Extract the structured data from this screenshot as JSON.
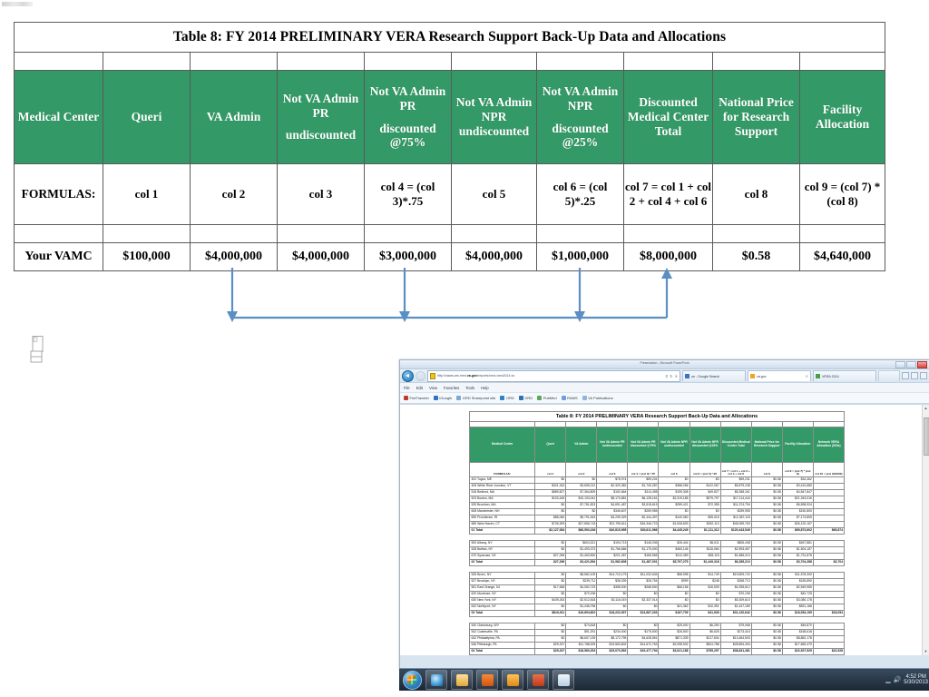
{
  "slide": {
    "table": {
      "title": "Table 8: FY 2014 PRELIMINARY VERA Research Support Back-Up Data and Allocations",
      "headers": [
        {
          "main": "Medical Center",
          "sub": ""
        },
        {
          "main": "Queri",
          "sub": ""
        },
        {
          "main": "VA Admin",
          "sub": ""
        },
        {
          "main": "Not VA Admin PR",
          "sub": "undiscounted"
        },
        {
          "main": "Not VA Admin PR",
          "sub": "discounted @75%"
        },
        {
          "main": "Not VA Admin NPR undiscounted",
          "sub": ""
        },
        {
          "main": "Not VA Admin NPR",
          "sub": "discounted @25%"
        },
        {
          "main": "Discounted Medical Center Total",
          "sub": ""
        },
        {
          "main": "National Price for Research Support",
          "sub": ""
        },
        {
          "main": "Facility Allocation",
          "sub": ""
        }
      ],
      "formula_label": "FORMULAS:",
      "formulas": [
        "col 1",
        "col 2",
        "col 3",
        "col 4 = (col 3)*.75",
        "col 5",
        "col 6 = (col 5)*.25",
        "col 7 = col 1 + col 2 + col 4 + col 6",
        "col 8",
        "col 9 = (col 7) * (col 8)"
      ],
      "data_row_label": "Your VAMC",
      "data_values": [
        "$100,000",
        "$4,000,000",
        "$4,000,000",
        "$3,000,000",
        "$4,000,000",
        "$1,000,000",
        "$8,000,000",
        "$0.58",
        "$4,640,000"
      ]
    },
    "arrows": {
      "color": "#5b8fc4",
      "description": "col 1, col 4 and col 6 flow down and combine into col 7"
    }
  },
  "browser": {
    "window_title": "Presentation - Microsoft PowerPoint",
    "address": {
      "url_prefix": "http://vaww.ars.med.",
      "url_bold": "va.gov",
      "url_suffix": "/reports/vera-vera2014.vs",
      "search_icon": "search-icon",
      "refresh_icon": "refresh-icon",
      "stop_icon": "close-icon"
    },
    "tabs": [
      {
        "title": "ue - Google Search",
        "favicon": "#3b73c4"
      },
      {
        "title": "va.gov",
        "favicon": "#f0a32a"
      },
      {
        "title": "VERA 2014",
        "favicon": "#4a9e4a"
      }
    ],
    "menu": [
      "File",
      "Edit",
      "View",
      "Favorites",
      "Tools",
      "Help"
    ],
    "favorites": [
      {
        "label": "FedTraveler",
        "color": "#c0392b"
      },
      {
        "label": "iGoogle",
        "color": "#2f6fc4"
      },
      {
        "label": "ORD Sharepoint site",
        "color": "#7ea6d4"
      },
      {
        "label": "ORD",
        "color": "#2f80c4"
      },
      {
        "label": "ORD",
        "color": "#2f6fb4"
      },
      {
        "label": "PubMed",
        "color": "#5ba85b"
      },
      {
        "label": "RAMS",
        "color": "#6f9fd8"
      },
      {
        "label": "VA Publications",
        "color": "#8fb5dd"
      }
    ],
    "document": {
      "title": "Table 8:  FY 2014 PRELIMINARY VERA Research Support Back-Up Data and Allocations",
      "headers": [
        "Medical Center",
        "Queri",
        "VA Admin",
        "Not VA Admin PR undiscounted",
        "Not VA Admin PR discounted @75%",
        "Not VA Admin NPR undiscounted",
        "Not VA Admin NPR discounted @25%",
        "Discounted Medical Center Total",
        "National Price for Research Support",
        "Facility Allocation",
        "Network VERA Allocation (000s)"
      ],
      "formula_label": "FORMULAS:",
      "formulas": [
        "col 1",
        "col 2",
        "col 3",
        "col 4 = (col 3) *.75",
        "col 5",
        "col 6 = (col 5) *.25",
        "col 7 = col 1 + col 2 + col 4 + col 6",
        "col 8",
        "col 9 = (col 7) * (col 8)",
        "col 10 = (col 9)/1000)"
      ],
      "rows": [
        {
          "name": "402 Togus, ME",
          "cells": [
            "$0",
            "$0",
            "$78,974",
            "$59,231",
            "$0",
            "$0",
            "$59,231",
            "$0.58",
            "$34,362",
            ""
          ]
        },
        {
          "name": "405 White River Junction, VT",
          "cells": [
            "$321,343",
            "$3,695,212",
            "$2,320,382",
            "$1,740,287",
            "$488,266",
            "$122,067",
            "$5,879,108",
            "$0.58",
            "$3,410,680",
            ""
          ]
        },
        {
          "name": "518 Bedford, MA",
          "cells": [
            "$889,827",
            "$7,364,809",
            "$152,664",
            "$114,498",
            "$199,308",
            "$49,827",
            "$8,358,161",
            "$0.58",
            "$4,847,847",
            ""
          ]
        },
        {
          "name": "523 Boston, MA",
          "cells": [
            "$103,445",
            "$10,103,041",
            "$8,170,881",
            "$6,128,161",
            "$2,319,185",
            "$579,797",
            "$17,114,444",
            "$0.58",
            "$21,343,016",
            ""
          ]
        },
        {
          "name": "525 Brockton, MA",
          "cells": [
            "$0",
            "$7,781,823",
            "$4,691,487",
            "$3,518,615",
            "$289,421",
            "$72,355",
            "$11,374,794",
            "$0.58",
            "$6,598,924",
            ""
          ]
        },
        {
          "name": "608 Manchester, NH",
          "cells": [
            "$0",
            "$0",
            "$346,607",
            "$259,955",
            "$0",
            "$0",
            "$259,955",
            "$0.58",
            "$150,800",
            ""
          ]
        },
        {
          "name": "650 Providence, RI",
          "cells": [
            "$86,060",
            "$9,791,543",
            "$3,239,329",
            "$2,444,497",
            "$140,060",
            "$35,015",
            "$12,367,115",
            "$0.58",
            "$7,174,805",
            ""
          ]
        },
        {
          "name": "689 West Haven, CT",
          "cells": [
            "$726,309",
            "$27,856,718",
            "$21,795,611",
            "$16,346,723",
            "$1,008,609",
            "$252,113",
            "$45,059,763",
            "$0.58",
            "$26,120,167",
            ""
          ]
        },
        {
          "name": "01 Total",
          "cells": [
            "$2,127,084",
            "$66,593,166",
            "$40,815,955",
            "$30,611,966",
            "$4,445,249",
            "$1,111,312",
            "$120,443,549",
            "$0.58",
            "$69,873,602",
            "$69,874"
          ],
          "total": true
        },
        {
          "name": "",
          "cells": [
            "",
            "",
            "",
            "",
            "",
            "",
            "",
            "",
            "",
            ""
          ],
          "blank": true
        },
        {
          "name": "500 Albany, NY",
          "cells": [
            "$0",
            "$604,321",
            "$194,713",
            "$146,036",
            "$26,444",
            "$6,611",
            "$806,448",
            "$0.58",
            "$467,881",
            ""
          ]
        },
        {
          "name": "528 Buffalo, NY",
          "cells": [
            "$0",
            "$1,493,373",
            "$1,766,666",
            "$1,175,000",
            "$460,146",
            "$115,084",
            "$2,593,457",
            "$0.58",
            "$1,504,157",
            ""
          ]
        },
        {
          "name": "670 Syracuse, NY",
          "cells": [
            "$27,296",
            "$1,463,900",
            "$221,287",
            "$165,965",
            "$112,459",
            "$28,115",
            "$1,685,210",
            "$0.58",
            "$1,731,878",
            ""
          ]
        },
        {
          "name": "02 Total",
          "cells": [
            "$27,296",
            "$3,421,594",
            "$1,982,608",
            "$1,487,001",
            "$5,797,275",
            "$1,449,318",
            "$6,285,210",
            "$0.58",
            "$3,704,288",
            "$3,704"
          ],
          "total": true
        },
        {
          "name": "",
          "cells": [
            "",
            "",
            "",
            "",
            "",
            "",
            "",
            "",
            "",
            ""
          ],
          "blank": true
        },
        {
          "name": "526 Bronx, NY",
          "cells": [
            "$0",
            "$8,582,109",
            "$14,710,179",
            "$11,032,634",
            "$58,998",
            "$14,749",
            "$19,809,722",
            "$0.58",
            "$11,578,300",
            ""
          ]
        },
        {
          "name": "527 Brooklyn, NY",
          "cells": [
            "$0",
            "$239,711",
            "$38,339",
            "$28,754",
            "$999",
            "$248",
            "$268,713",
            "$0.58",
            "$155,890",
            ""
          ]
        },
        {
          "name": "561 East Orange, NJ",
          "cells": [
            "$17,848",
            "$4,052,723",
            "$358,000",
            "$268,500",
            "$66,156",
            "$16,539",
            "$4,395,612",
            "$0.58",
            "$2,549,955",
            ""
          ]
        },
        {
          "name": "620 Montrose, NY",
          "cells": [
            "$0",
            "$70,196",
            "$0",
            "$0",
            "$0",
            "$0",
            "$70,196",
            "$0.58",
            "$40,725",
            ""
          ]
        },
        {
          "name": "630 New York, NY",
          "cells": [
            "$439,263",
            "$2,512,818",
            "$3,116,019",
            "$2,337,014",
            "$0",
            "$0",
            "$5,309,610",
            "$0.58",
            "$3,080,178",
            ""
          ]
        },
        {
          "name": "632 Northport, NY",
          "cells": [
            "$0",
            "$1,436,798",
            "$0",
            "$0",
            "$41,362",
            "$10,391",
            "$1,447,189",
            "$0.58",
            "$831,168",
            ""
          ]
        },
        {
          "name": "03 Total",
          "cells": [
            "$816,911",
            "$16,894,602",
            "$18,222,937",
            "$13,667,203",
            "$167,709",
            "$41,926",
            "$31,120,642",
            "$0.58",
            "$18,054,199",
            "$18,054"
          ],
          "total": true
        },
        {
          "name": "",
          "cells": [
            "",
            "",
            "",
            "",
            "",
            "",
            "",
            "",
            "",
            ""
          ],
          "blank": true
        },
        {
          "name": "540 Clarksburg, WV",
          "cells": [
            "$0",
            "$73,818",
            "$0",
            "$0",
            "$25,000",
            "$6,250",
            "$79,068",
            "$0.58",
            "$45,870",
            ""
          ]
        },
        {
          "name": "542 Coatesville, PA",
          "cells": [
            "$0",
            "$91,291",
            "$234,000",
            "$175,500",
            "$26,500",
            "$6,625",
            "$273,416",
            "$0.58",
            "$158,618",
            ""
          ]
        },
        {
          "name": "642 Philadelphia, PA",
          "cells": [
            "$0",
            "$8,607,139",
            "$8,172,795",
            "$4,628,551",
            "$871,339",
            "$217,834",
            "$13,484,503",
            "$0.58",
            "$8,862,178",
            ""
          ]
        },
        {
          "name": "646 Pittsburgh, PA",
          "cells": [
            "$29,337",
            "$11,788,009",
            "$19,563,802",
            "$14,672,763",
            "$2,098,932",
            "$524,788",
            "$28,894,494",
            "$0.58",
            "$17,669,479",
            ""
          ]
        },
        {
          "name": "04 Total",
          "cells": [
            "$29,337",
            "$18,560,254",
            "$25,070,592",
            "$19,477,794",
            "$3,021,188",
            "$755,297",
            "$38,831,481",
            "$0.58",
            "$22,527,529",
            "$22,528"
          ],
          "total": true
        }
      ]
    },
    "scrollbar": {
      "up_icon": "chevron-up-icon",
      "down_icon": "chevron-down-icon"
    }
  },
  "taskbar": {
    "start_icon": "windows-start-orb",
    "pinned": [
      {
        "name": "internet-explorer-icon",
        "color": "#7fbde5"
      },
      {
        "name": "file-explorer-icon",
        "color": "#f0c040"
      },
      {
        "name": "media-player-icon",
        "color": "#e8620f"
      },
      {
        "name": "outlook-icon",
        "color": "#f2a020"
      },
      {
        "name": "powerpoint-icon",
        "color": "#d04423"
      },
      {
        "name": "document-window-icon",
        "color": "#c8d8e6"
      }
    ],
    "clock_time": "4:52 PM",
    "clock_date": "5/30/2013"
  }
}
